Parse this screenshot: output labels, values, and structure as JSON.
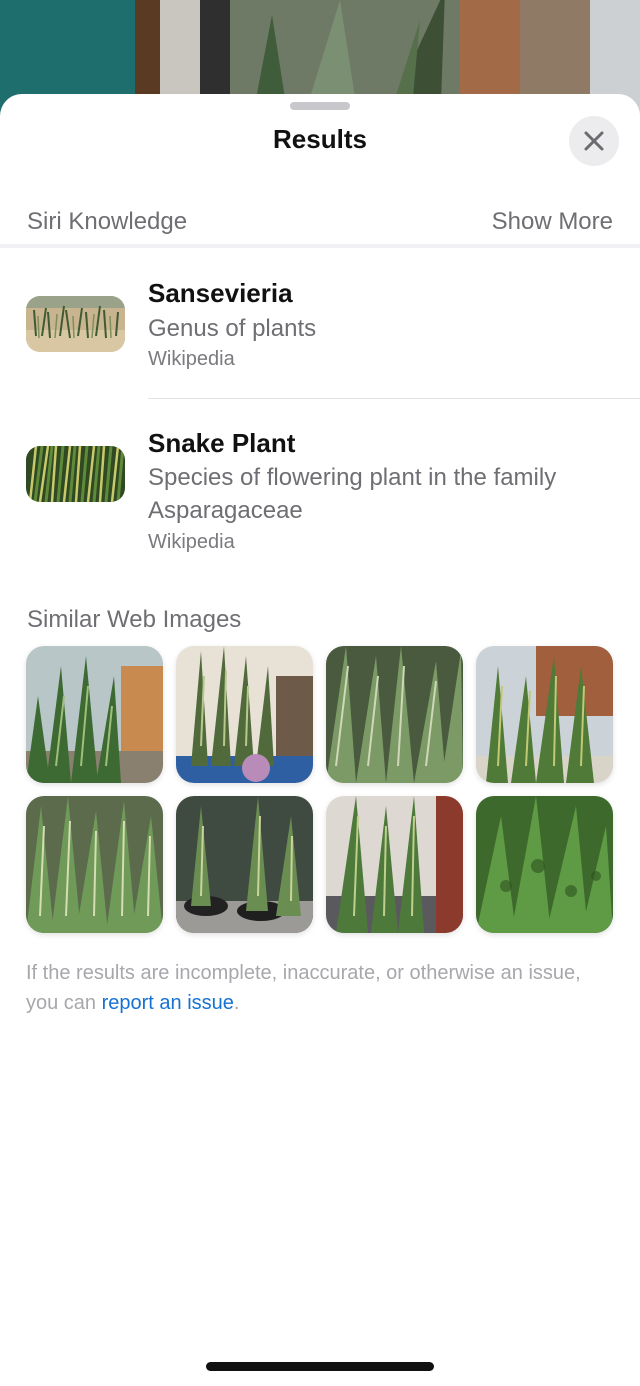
{
  "sheet": {
    "title": "Results",
    "close_icon": "close-icon"
  },
  "siri_knowledge": {
    "label": "Siri Knowledge",
    "show_more": "Show More",
    "results": [
      {
        "title": "Sansevieria",
        "subtitle": "Genus of plants",
        "source": "Wikipedia"
      },
      {
        "title": "Snake Plant",
        "subtitle": "Species of flowering plant in the family Asparagaceae",
        "source": "Wikipedia"
      }
    ]
  },
  "similar_web_images": {
    "label": "Similar Web Images",
    "count": 8
  },
  "footer": {
    "text": "If the results are incomplete, inaccurate, or otherwise an issue, you can ",
    "link": "report an issue",
    "end": "."
  },
  "colors": {
    "accent_link": "#1572d3",
    "secondary_text": "#6e6e73",
    "plant_green": "#3e6b35"
  }
}
